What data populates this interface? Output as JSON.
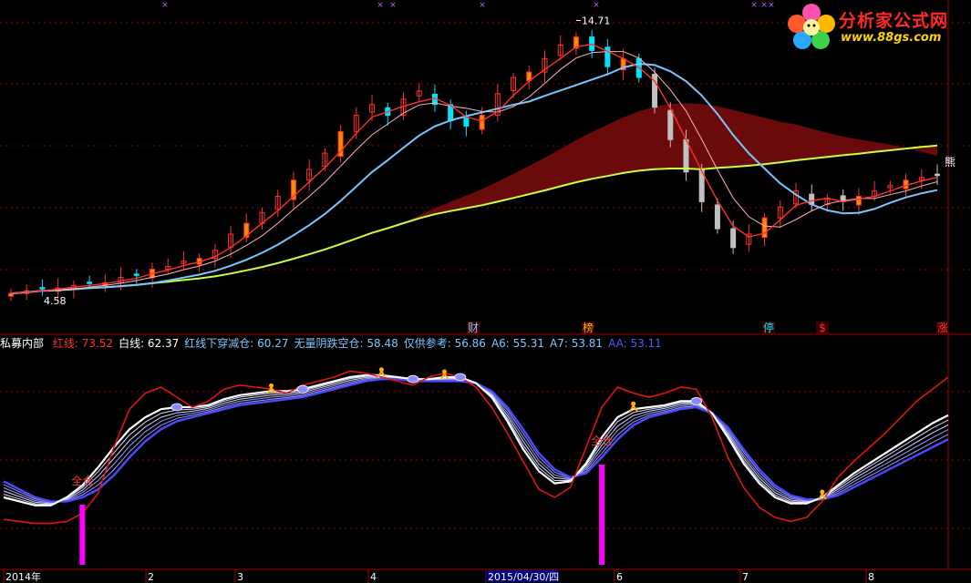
{
  "logo": {
    "title": "分析家公式网",
    "url": "www.88gs.com"
  },
  "price_labels": {
    "high": "14.71",
    "low": "4.58"
  },
  "event_markers": [
    "财",
    "榜",
    "停",
    "$",
    "涨"
  ],
  "end_marker": "熊",
  "indicator": {
    "name": "私募内部",
    "items": [
      {
        "label": "红线: 73.52",
        "color": "#ff3030"
      },
      {
        "label": "白线: 62.37",
        "color": "#ffffff"
      },
      {
        "label": "红线下穿减仓: 60.27",
        "color": "#7ec8ff"
      },
      {
        "label": "无量阴跌空仓: 58.48",
        "color": "#7ec8ff"
      },
      {
        "label": "仅供参考: 56.86",
        "color": "#7ec8ff"
      },
      {
        "label": "A6: 55.31",
        "color": "#7ec8ff"
      },
      {
        "label": "A7: 53.81",
        "color": "#7ec8ff"
      },
      {
        "label": "AA: 53.11",
        "color": "#4a5bff"
      }
    ],
    "signal_text": "全仓"
  },
  "time_axis": [
    "2014年",
    "2",
    "3",
    "4",
    "2015/04/30/四",
    "6",
    "7",
    "8"
  ],
  "chart_data": [
    {
      "type": "candlestick",
      "title": "",
      "y_range": [
        4.0,
        15.2
      ],
      "labeled_values": {
        "high": 14.71,
        "low": 4.58
      },
      "close_approx": [
        4.6,
        4.7,
        4.8,
        4.8,
        4.9,
        5.0,
        5.0,
        5.2,
        5.3,
        5.5,
        5.6,
        5.8,
        5.9,
        6.2,
        6.8,
        7.2,
        7.6,
        8.2,
        8.8,
        9.2,
        9.8,
        10.6,
        11.2,
        11.6,
        11.2,
        11.8,
        12.1,
        11.6,
        11.0,
        10.8,
        11.2,
        12.0,
        12.6,
        12.8,
        13.3,
        13.8,
        14.1,
        13.6,
        13.0,
        13.3,
        12.6,
        11.5,
        10.3,
        9.1,
        8.0,
        7.0,
        6.3,
        6.8,
        7.4,
        7.8,
        8.4,
        7.9,
        8.1,
        8.0,
        8.2,
        8.4,
        8.6,
        8.8,
        8.9,
        9.0
      ],
      "colors": {
        "up": "#ff3030",
        "down": "#00e5ff",
        "down_late": "#c0c0c0",
        "ma_short": "#ff3030",
        "ma_mid": "#ffb0c0",
        "ma_long": "#79c6ff",
        "ma_slow": "#c8ff40",
        "cloud": "#6b0a0a"
      }
    },
    {
      "type": "line",
      "title": "私募内部",
      "y_range": [
        0,
        100
      ],
      "series": [
        {
          "name": "红线",
          "values": [
            19,
            18,
            17,
            17,
            18,
            22,
            32,
            55,
            74,
            82,
            85,
            80,
            75,
            78,
            84,
            86,
            85,
            84,
            82,
            86,
            88,
            90,
            93,
            92,
            90,
            88,
            86,
            90,
            92,
            90,
            85,
            75,
            62,
            48,
            34,
            30,
            35,
            55,
            75,
            85,
            82,
            80,
            82,
            85,
            84,
            70,
            50,
            35,
            25,
            20,
            18,
            20,
            28,
            40,
            48,
            55,
            62,
            70,
            78,
            84,
            90
          ]
        },
        {
          "name": "白线",
          "values": [
            30,
            28,
            26,
            26,
            30,
            36,
            45,
            55,
            64,
            70,
            74,
            75,
            75,
            76,
            79,
            81,
            82,
            83,
            83,
            84,
            86,
            88,
            90,
            91,
            91,
            90,
            89,
            89,
            90,
            90,
            87,
            80,
            68,
            54,
            43,
            37,
            38,
            47,
            60,
            70,
            74,
            75,
            76,
            78,
            78,
            72,
            60,
            47,
            37,
            30,
            27,
            27,
            30,
            36,
            42,
            47,
            52,
            57,
            62,
            67,
            71
          ]
        },
        {
          "name": "AA",
          "values": [
            38,
            34,
            30,
            28,
            28,
            30,
            34,
            41,
            50,
            58,
            64,
            68,
            70,
            72,
            74,
            76,
            77,
            78,
            79,
            80,
            82,
            84,
            86,
            88,
            89,
            89,
            88,
            88,
            88,
            88,
            87,
            83,
            75,
            64,
            52,
            44,
            40,
            42,
            50,
            59,
            66,
            70,
            72,
            74,
            75,
            72,
            65,
            54,
            44,
            36,
            31,
            29,
            29,
            31,
            35,
            39,
            43,
            47,
            51,
            55,
            59
          ]
        }
      ],
      "signal_points": [
        5,
        38
      ]
    }
  ]
}
